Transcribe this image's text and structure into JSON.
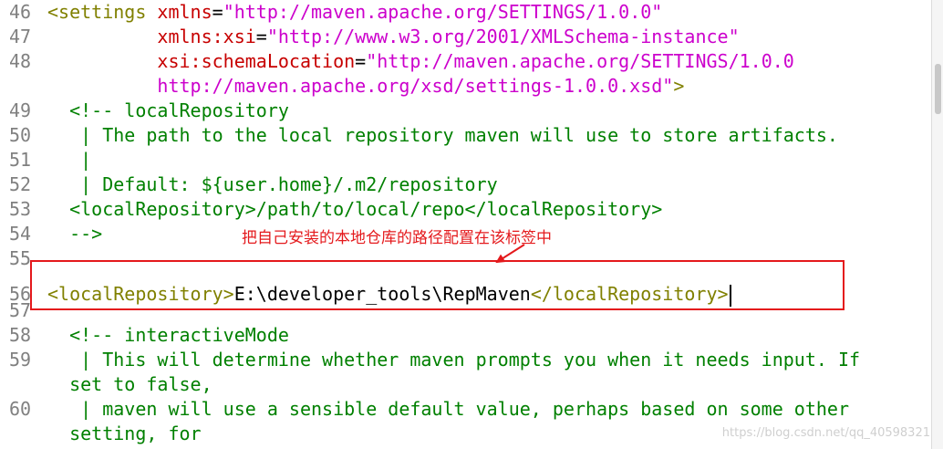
{
  "editor": {
    "lines": [
      {
        "num": "46",
        "parts": [
          [
            "tag",
            "<settings "
          ],
          [
            "attr",
            "xmlns"
          ],
          [
            "txt",
            "="
          ],
          [
            "val",
            "\"http://maven.apache.org/SETTINGS/1.0.0\""
          ]
        ]
      },
      {
        "num": "47",
        "parts": [
          [
            "txt",
            "          "
          ],
          [
            "attr",
            "xmlns:xsi"
          ],
          [
            "txt",
            "="
          ],
          [
            "val",
            "\"http://www.w3.org/2001/XMLSchema-instance\""
          ]
        ]
      },
      {
        "num": "48",
        "parts": [
          [
            "txt",
            "          "
          ],
          [
            "attr",
            "xsi:schemaLocation"
          ],
          [
            "txt",
            "="
          ],
          [
            "val",
            "\"http://maven.apache.org/SETTINGS/1.0.0"
          ]
        ]
      },
      {
        "num": "",
        "parts": [
          [
            "txt",
            "          "
          ],
          [
            "val",
            "http://maven.apache.org/xsd/settings-1.0.0.xsd\""
          ],
          [
            "tag",
            ">"
          ]
        ]
      },
      {
        "num": "49",
        "parts": [
          [
            "cmt",
            "  <!-- localRepository"
          ]
        ]
      },
      {
        "num": "50",
        "parts": [
          [
            "cmt",
            "   | The path to the local repository maven will use to store artifacts."
          ]
        ]
      },
      {
        "num": "51",
        "parts": [
          [
            "cmt",
            "   |"
          ]
        ]
      },
      {
        "num": "52",
        "parts": [
          [
            "cmt",
            "   | Default: ${user.home}/.m2/repository"
          ]
        ]
      },
      {
        "num": "53",
        "parts": [
          [
            "cmt",
            "  <localRepository>/path/to/local/repo</localRepository>"
          ]
        ]
      },
      {
        "num": "54",
        "parts": [
          [
            "cmt",
            "  -->"
          ]
        ]
      },
      {
        "num": "55",
        "parts": []
      },
      {
        "num": "56",
        "parts": [
          [
            "tag",
            "<localRepository>"
          ],
          [
            "txt",
            "E:\\developer_tools\\RepMaven"
          ],
          [
            "tag",
            "</localRepository>"
          ]
        ],
        "caret": true
      },
      {
        "num": "57",
        "parts": []
      },
      {
        "num": "58",
        "parts": [
          [
            "cmt",
            "  <!-- interactiveMode"
          ]
        ]
      },
      {
        "num": "59",
        "parts": [
          [
            "cmt",
            "   | This will determine whether maven prompts you when it needs input. If"
          ]
        ]
      },
      {
        "num": "",
        "parts": [
          [
            "cmt",
            "  set to false,"
          ]
        ]
      },
      {
        "num": "60",
        "parts": [
          [
            "cmt",
            "   | maven will use a sensible default value, perhaps based on some other"
          ]
        ]
      },
      {
        "num": "",
        "parts": [
          [
            "cmt",
            "  setting, for"
          ]
        ]
      }
    ]
  },
  "annotation": {
    "text": "把自己安装的本地仓库的路径配置在该标签中",
    "color": "#e4191c"
  },
  "watermark": "https://blog.csdn.net/qq_40598321"
}
